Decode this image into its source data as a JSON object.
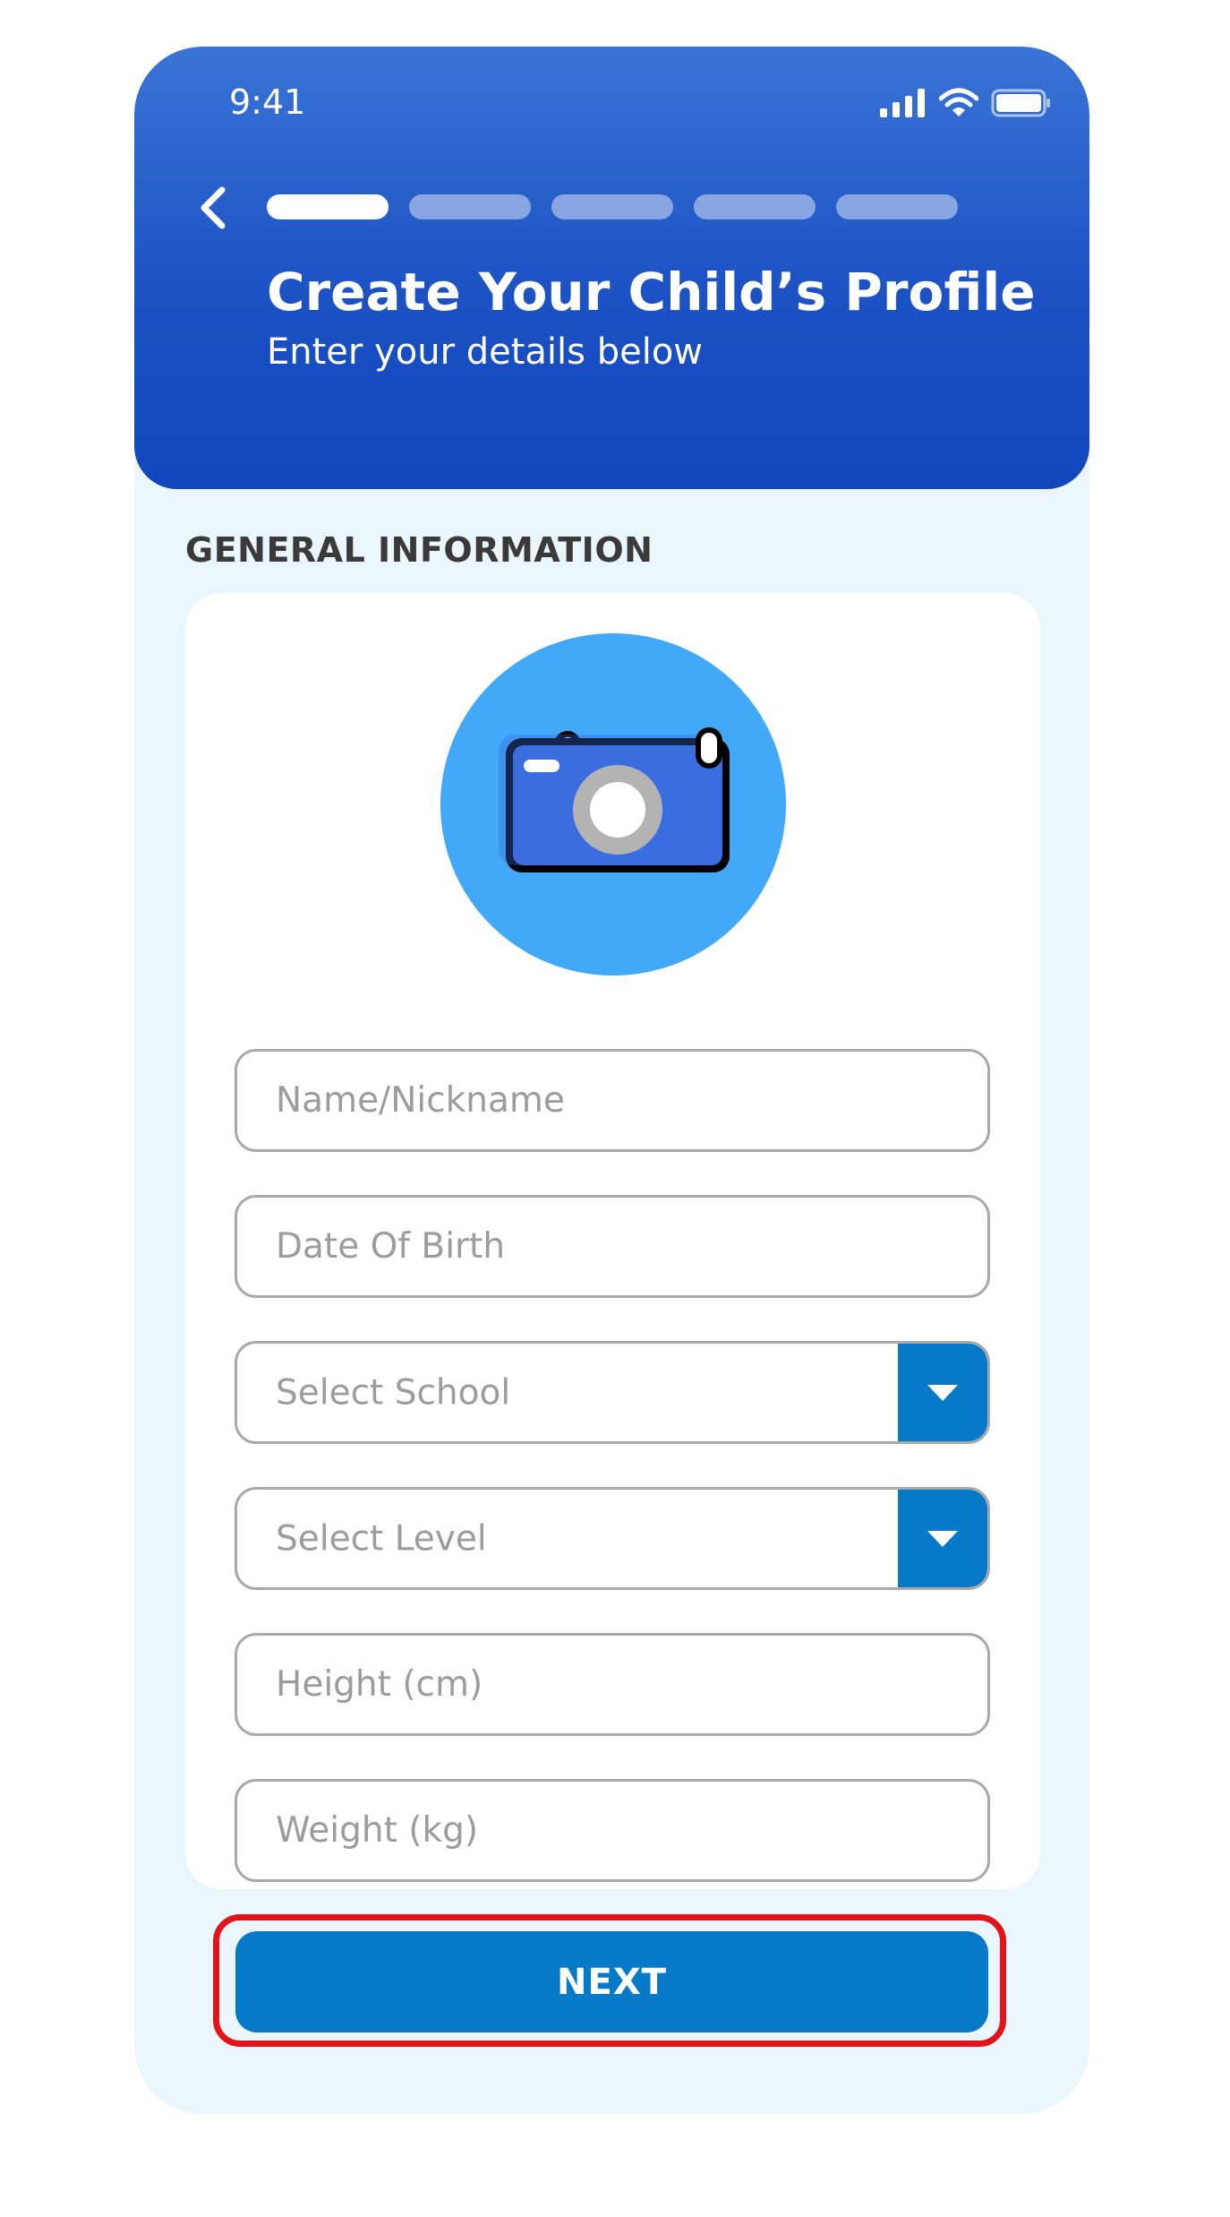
{
  "status_bar": {
    "time": "9:41"
  },
  "header": {
    "back_icon": "chevron-left-icon",
    "progress": {
      "total_steps": 5,
      "current_step": 1
    },
    "title": "Create Your Child’s Profile",
    "subtitle": "Enter your details below"
  },
  "section": {
    "label": "GENERAL INFORMATION"
  },
  "form": {
    "photo_icon": "camera-icon",
    "name_placeholder": "Name/Nickname",
    "dob_placeholder": "Date Of Birth",
    "school_placeholder": "Select School",
    "level_placeholder": "Select Level",
    "height_placeholder": "Height (cm)",
    "weight_placeholder": "Weight (kg)",
    "dropdown_icon": "caret-down-icon"
  },
  "actions": {
    "next_label": "NEXT"
  },
  "colors": {
    "header_top": "#3a74d6",
    "header_bottom": "#1246bd",
    "page_bg": "#eaf5fc",
    "accent": "#0679c8",
    "avatar_bg": "#42a8f8",
    "highlight": "#e2131a"
  }
}
